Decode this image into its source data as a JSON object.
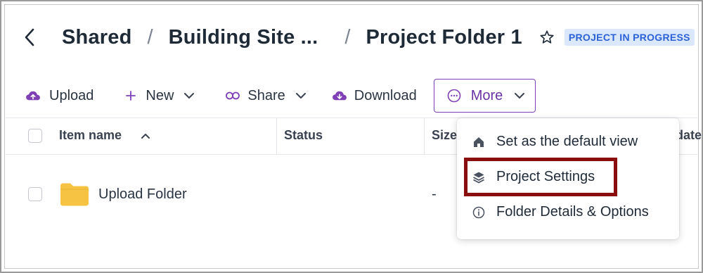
{
  "breadcrumb": {
    "items": [
      "Shared",
      "Building Site ...",
      "Project Folder 1"
    ],
    "separator": "/"
  },
  "status_badge": "PROJECT IN PROGRESS",
  "toolbar": {
    "upload_label": "Upload",
    "new_label": "New",
    "share_label": "Share",
    "download_label": "Download",
    "more_label": "More"
  },
  "table": {
    "columns": [
      "Item name",
      "Status",
      "Size",
      "date"
    ],
    "sort_indicator": "^",
    "rows": [
      {
        "name": "Upload Folder",
        "status": "",
        "size": "-"
      }
    ]
  },
  "more_menu": {
    "items": [
      {
        "label": "Set as the default view",
        "icon": "home-icon"
      },
      {
        "label": "Project Settings",
        "icon": "layers-icon"
      },
      {
        "label": "Folder Details & Options",
        "icon": "info-icon"
      }
    ]
  },
  "colors": {
    "accent": "#7e40b4",
    "badge_bg": "#dbe7fb",
    "badge_text": "#2b62d8",
    "folder": "#f6c343",
    "highlight_box": "#8b0e0e"
  }
}
